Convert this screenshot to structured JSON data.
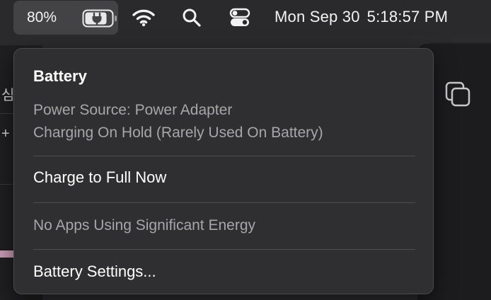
{
  "menubar": {
    "battery_percent": "80%",
    "date": "Mon Sep 30",
    "time": "5:18:57 PM",
    "icons": [
      "battery-charging-icon",
      "wifi-icon",
      "search-icon",
      "control-center-icon"
    ]
  },
  "background": {
    "left_glyphs": [
      "심",
      "+"
    ]
  },
  "battery_menu": {
    "title": "Battery",
    "power_source": "Power Source: Power Adapter",
    "charging_status": "Charging On Hold (Rarely Used On Battery)",
    "charge_full": "Charge to Full Now",
    "energy_status": "No Apps Using Significant Energy",
    "settings": "Battery Settings..."
  }
}
